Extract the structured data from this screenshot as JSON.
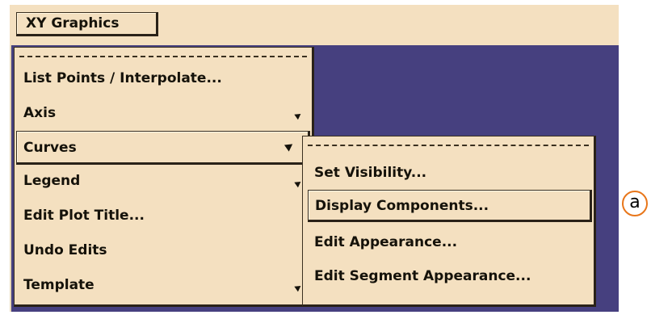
{
  "menubar": {
    "menu_label": "XY Graphics"
  },
  "main_menu": {
    "items": [
      {
        "label": "List Points / Interpolate...",
        "submenu": false
      },
      {
        "label": "Axis",
        "submenu": true
      },
      {
        "label": "Curves",
        "submenu": true,
        "active": true
      },
      {
        "label": "Legend",
        "submenu": true
      },
      {
        "label": "Edit Plot Title...",
        "submenu": false
      },
      {
        "label": "Undo Edits",
        "submenu": false
      },
      {
        "label": "Template",
        "submenu": true
      }
    ]
  },
  "curves_submenu": {
    "items": [
      {
        "label": "Set Visibility..."
      },
      {
        "label": "Display Components...",
        "active": true
      },
      {
        "label": "Edit Appearance..."
      },
      {
        "label": "Edit Segment Appearance..."
      }
    ]
  },
  "callout": {
    "label": "a"
  },
  "colors": {
    "menu_bg": "#f4e0c0",
    "canvas_bg": "#46407f",
    "callout_ring": "#e8761a"
  }
}
